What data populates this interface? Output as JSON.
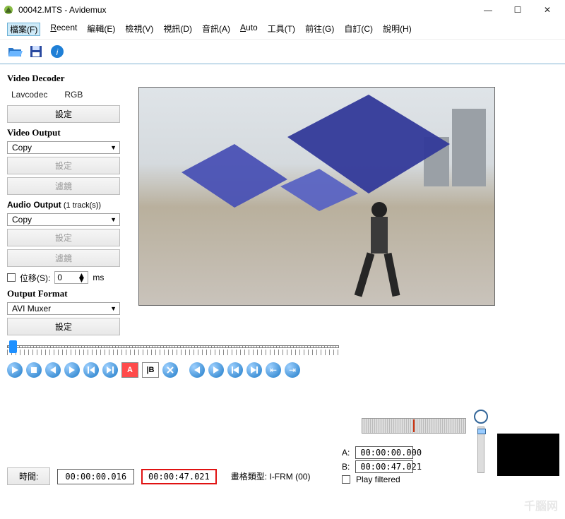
{
  "window": {
    "title": "00042.MTS - Avidemux",
    "min": "—",
    "max": "☐",
    "close": "✕"
  },
  "menu": {
    "file": {
      "label": "檔案(F)"
    },
    "recent": {
      "label": "Recent"
    },
    "edit": {
      "label": "編輯(E)"
    },
    "view": {
      "label": "檢視(V)"
    },
    "video": {
      "label": "視訊(D)"
    },
    "audio": {
      "label": "音訊(A)"
    },
    "auto": {
      "label": "Auto"
    },
    "tools": {
      "label": "工具(T)"
    },
    "goto": {
      "label": "前往(G)"
    },
    "custom": {
      "label": "自訂(C)"
    },
    "help": {
      "label": "說明(H)"
    }
  },
  "sidebar": {
    "video_decoder": {
      "title": "Video Decoder",
      "codec": "Lavcodec",
      "mode": "RGB",
      "config": "設定"
    },
    "video_output": {
      "title": "Video Output",
      "value": "Copy",
      "config": "設定",
      "filters": "濾鏡"
    },
    "audio_output": {
      "title": "Audio Output",
      "tracks": "(1 track(s))",
      "value": "Copy",
      "config": "設定",
      "filters": "濾鏡",
      "shift": "位移(S):",
      "shift_value": "0",
      "unit": "ms"
    },
    "output_format": {
      "title": "Output Format",
      "value": "AVI Muxer",
      "config": "設定"
    }
  },
  "timeline": {
    "time_label": "時間:",
    "current": "00:00:00.016",
    "total": "00:00:47.021",
    "frame_label": "畫格類型:",
    "frame_type": "I-FRM (00)"
  },
  "markers": {
    "A_label": "A:",
    "A": "00:00:00.000",
    "B_label": "B:",
    "B": "00:00:47.021",
    "play_filtered": "Play filtered"
  },
  "icons": {
    "open": "open-icon",
    "save": "save-icon",
    "info": "info-icon"
  },
  "watermark": "千腦网"
}
